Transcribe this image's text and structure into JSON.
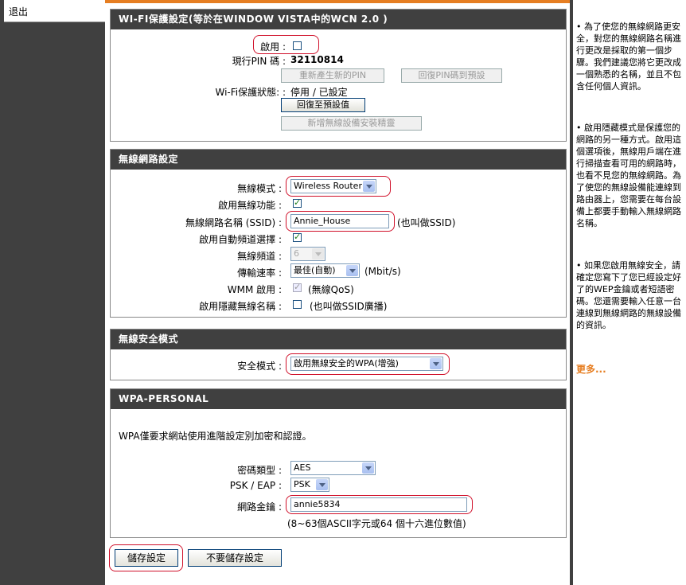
{
  "nav": {
    "logout": "退出"
  },
  "wps": {
    "title": "WI-FI保護設定(等於在WINDOW VISTA中的WCN 2.0 )",
    "enable_label": "啟用 :",
    "enabled": false,
    "pin_label": "現行PIN 碼 :",
    "pin_value": "32110814",
    "regen_pin_button": "重新產生新的PIN",
    "reset_pin_button": "回復PIN碼到預設",
    "status_label": "Wi-Fi保護狀態: :",
    "status_value": "停用 / 已設定",
    "restore_default_button": "回復至預設值",
    "add_device_wizard_button": "新增無線設備安裝精靈"
  },
  "wireless": {
    "title": "無線網路設定",
    "mode_label": "無線模式 :",
    "mode_value": "Wireless Router",
    "enable_label": "啟用無線功能 :",
    "enable_checked": true,
    "ssid_label": "無線網路名稱 (SSID) :",
    "ssid_value": "Annie_House",
    "ssid_note": "(也叫做SSID)",
    "auto_channel_label": "啟用自動頻道選擇 :",
    "auto_channel_checked": true,
    "channel_label": "無線頻道 :",
    "channel_value": "6",
    "rate_label": "傳輸速率 :",
    "rate_value": "最佳(自動)",
    "rate_unit": "(Mbit/s)",
    "wmm_label": "WMM 啟用 :",
    "wmm_checked": true,
    "wmm_note": "(無線QoS)",
    "hidden_label": "啟用隱藏無線名稱 :",
    "hidden_checked": false,
    "hidden_note": "(也叫做SSID廣播)"
  },
  "security": {
    "title": "無線安全模式",
    "mode_label": "安全模式 :",
    "mode_value": "啟用無線安全的WPA(增強)"
  },
  "wpa": {
    "title": "WPA-PERSONAL",
    "description": "WPA僅要求網站使用進階設定別加密和認證。",
    "cipher_label": "密碼類型 :",
    "cipher_value": "AES",
    "psk_label": "PSK / EAP :",
    "psk_value": "PSK",
    "key_label": "網路金鑰 :",
    "key_value": "annie5834",
    "key_hint": "(8~63個ASCII字元或64 個十六進位數值)"
  },
  "actions": {
    "save_button": "儲存設定",
    "dont_save_button": "不要儲存設定"
  },
  "help": {
    "tip1": "• 為了使您的無線網路更安全，對您的無線網路名稱進行更改是採取的第一個步驟。我們建議您將它更改成一個熟悉的名稱，並且不包含任何個人資訊。",
    "tip2": "• 啟用隱藏模式是保護您的網路的另一種方式。啟用這個選項後，無線用戶端在進行掃描查看可用的網路時，也看不見您的無線網路。為了使您的無線設備能連線到路由器上，您需要在每台設備上都要手動輸入無線網路名稱。",
    "tip3": "• 如果您啟用無線安全，請確定您寫下了您已經設定好了的WEP金鑰或者短語密碼。您還需要輸入任意一台連線到無線網路的無線設備的資訊。",
    "more_link": "更多..."
  },
  "colors": {
    "header_bg": "#404040",
    "highlight": "#d0102a",
    "more_link": "#e67e22"
  }
}
